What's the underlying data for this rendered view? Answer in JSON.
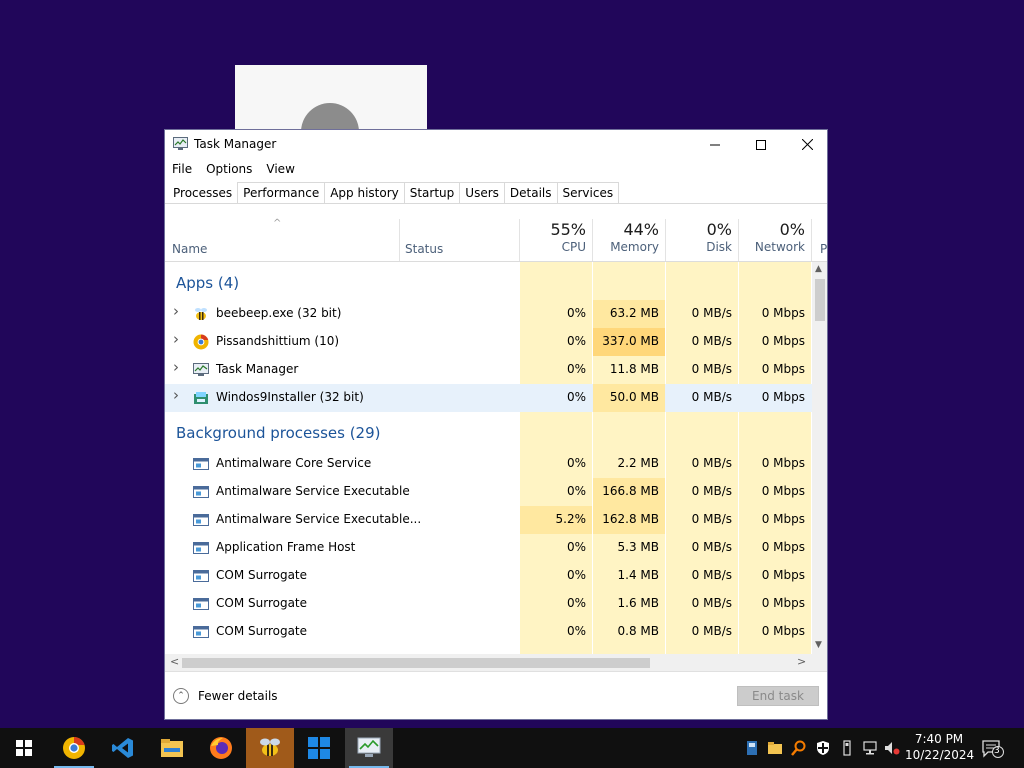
{
  "window": {
    "title": "Task Manager",
    "menu": [
      "File",
      "Options",
      "View"
    ],
    "tabs": [
      "Processes",
      "Performance",
      "App history",
      "Startup",
      "Users",
      "Details",
      "Services"
    ],
    "active_tab": "Processes"
  },
  "columns": {
    "name": "Name",
    "status": "Status",
    "cpu": {
      "pct": "55%",
      "label": "CPU"
    },
    "memory": {
      "pct": "44%",
      "label": "Memory"
    },
    "disk": {
      "pct": "0%",
      "label": "Disk"
    },
    "network": {
      "pct": "0%",
      "label": "Network"
    },
    "cut": "P"
  },
  "groups": {
    "apps": "Apps (4)",
    "background": "Background processes (29)"
  },
  "apps": [
    {
      "name": "beebeep.exe (32 bit)",
      "icon": "bee-icon",
      "cpu": "0%",
      "mem": "63.2 MB",
      "disk": "0 MB/s",
      "net": "0 Mbps"
    },
    {
      "name": "Pissandshittium (10)",
      "icon": "browser-icon",
      "cpu": "0%",
      "mem": "337.0 MB",
      "disk": "0 MB/s",
      "net": "0 Mbps"
    },
    {
      "name": "Task Manager",
      "icon": "task-manager-icon",
      "cpu": "0%",
      "mem": "11.8 MB",
      "disk": "0 MB/s",
      "net": "0 Mbps"
    },
    {
      "name": "Windos9Installer (32 bit)",
      "icon": "installer-icon",
      "cpu": "0%",
      "mem": "50.0 MB",
      "disk": "0 MB/s",
      "net": "0 Mbps"
    }
  ],
  "background": [
    {
      "name": "Antimalware Core Service",
      "cpu": "0%",
      "mem": "2.2 MB",
      "disk": "0 MB/s",
      "net": "0 Mbps"
    },
    {
      "name": "Antimalware Service Executable",
      "cpu": "0%",
      "mem": "166.8 MB",
      "disk": "0 MB/s",
      "net": "0 Mbps"
    },
    {
      "name": "Antimalware Service Executable...",
      "cpu": "5.2%",
      "mem": "162.8 MB",
      "disk": "0 MB/s",
      "net": "0 Mbps"
    },
    {
      "name": "Application Frame Host",
      "cpu": "0%",
      "mem": "5.3 MB",
      "disk": "0 MB/s",
      "net": "0 Mbps"
    },
    {
      "name": "COM Surrogate",
      "cpu": "0%",
      "mem": "1.4 MB",
      "disk": "0 MB/s",
      "net": "0 Mbps"
    },
    {
      "name": "COM Surrogate",
      "cpu": "0%",
      "mem": "1.6 MB",
      "disk": "0 MB/s",
      "net": "0 Mbps"
    },
    {
      "name": "COM Surrogate",
      "cpu": "0%",
      "mem": "0.8 MB",
      "disk": "0 MB/s",
      "net": "0 Mbps"
    }
  ],
  "footer": {
    "fewer_details": "Fewer details",
    "end_task": "End task"
  },
  "taskbar": {
    "time": "7:40 PM",
    "date": "10/22/2024",
    "notification_count": "3"
  },
  "colors": {
    "desktop": "#21065a",
    "heat_light": "#fff4c4",
    "heat_mid": "#ffe8a0",
    "heat_strong": "#ffd77a",
    "group_text": "#1c5499"
  }
}
